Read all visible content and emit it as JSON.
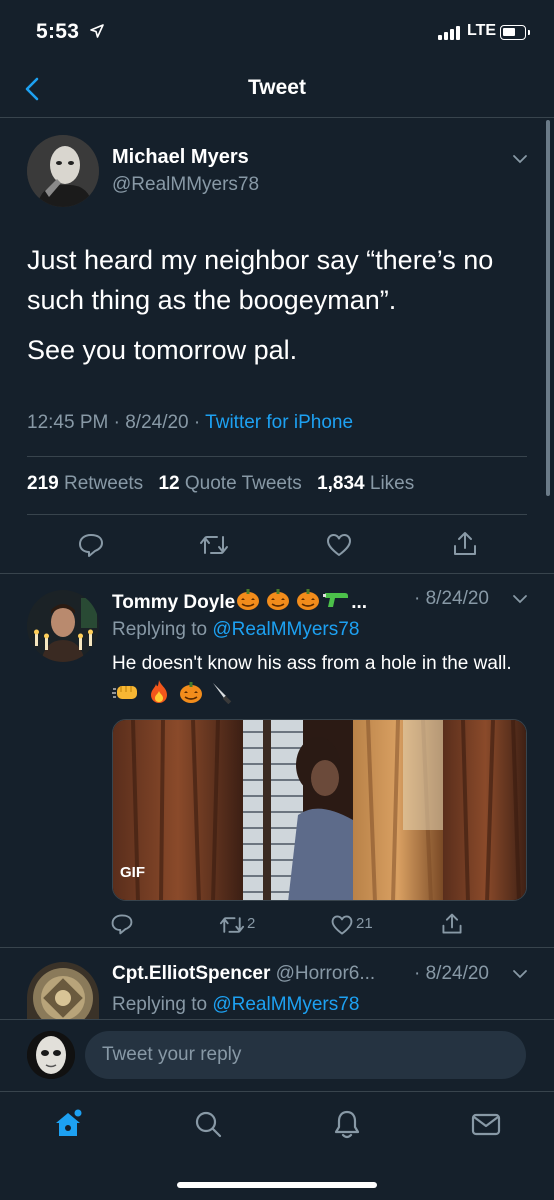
{
  "status_bar": {
    "time": "5:53",
    "network": "LTE"
  },
  "nav": {
    "title": "Tweet"
  },
  "main_tweet": {
    "author_name": "Michael Myers",
    "author_handle": "@RealMMyers78",
    "text_line1": "Just heard my neighbor say “there’s no such thing as the boogeyman”.",
    "text_line2": "See you tomorrow pal.",
    "time": "12:45 PM",
    "date": "8/24/20",
    "source": "Twitter for iPhone",
    "retweets": "219",
    "retweets_label": "Retweets",
    "quotes": "12",
    "quotes_label": "Quote Tweets",
    "likes": "1,834",
    "likes_label": "Likes"
  },
  "replies": [
    {
      "name": "Tommy Doyle",
      "name_suffix": "...",
      "date": "· 8/24/20",
      "replying_prefix": "Replying to",
      "replying_to": "@RealMMyers78",
      "text": "He doesn't know his ass from a hole in the wall.",
      "media_badge": "GIF",
      "retweet_count": "2",
      "like_count": "21"
    },
    {
      "name": "Cpt.ElliotSpencer",
      "handle": "@Horror6...",
      "date": "· 8/24/20",
      "replying_prefix": "Replying to",
      "replying_to": "@RealMMyers78"
    }
  ],
  "composer": {
    "placeholder": "Tweet your reply"
  },
  "colors": {
    "background": "#15202b",
    "accent": "#1da1f2",
    "secondary_text": "#8899a6",
    "border": "#38444d"
  },
  "tabs": [
    "home-icon",
    "search-icon",
    "notifications-icon",
    "messages-icon"
  ]
}
